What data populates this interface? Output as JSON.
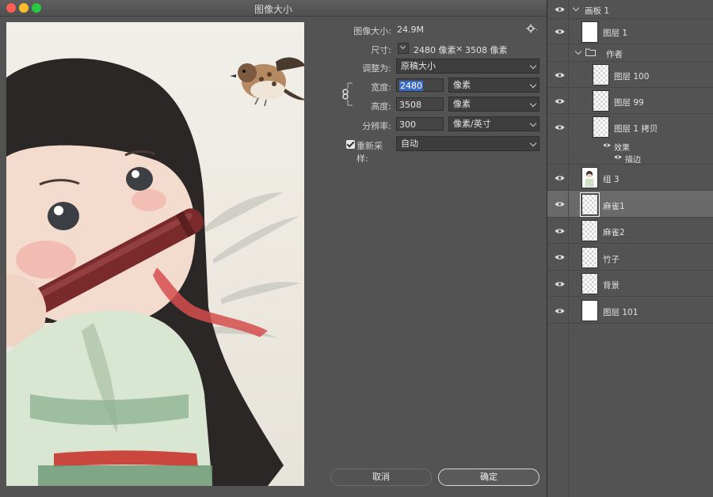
{
  "dialog": {
    "title": "图像大小",
    "image_size_label": "图像大小:",
    "image_size_value": "24.9M",
    "dimensions_label": "尺寸:",
    "dimensions_w": "2480 像素",
    "dimensions_x": "×",
    "dimensions_h": "3508 像素",
    "fit_to_label": "调整为:",
    "fit_to_value": "原稿大小",
    "width_label": "宽度:",
    "width_value": "2480",
    "width_unit": "像素",
    "height_label": "高度:",
    "height_value": "3508",
    "height_unit": "像素",
    "resolution_label": "分辨率:",
    "resolution_value": "300",
    "resolution_unit": "像素/英寸",
    "resample_label": "重新采样:",
    "resample_checked": true,
    "resample_value": "自动",
    "cancel_label": "取消",
    "ok_label": "确定"
  },
  "layers": {
    "artboard": "画板 1",
    "items": [
      {
        "name": "图层 1",
        "thumb": "white"
      },
      {
        "name": "作者",
        "thumb": "folder"
      },
      {
        "name": "图层 100",
        "thumb": "checker"
      },
      {
        "name": "图层 99",
        "thumb": "checker"
      },
      {
        "name": "图层 1 拷贝",
        "thumb": "checker"
      },
      {
        "name": "效果",
        "thumb": "none"
      },
      {
        "name": "描边",
        "thumb": "none"
      },
      {
        "name": "组 3",
        "thumb": "figure"
      },
      {
        "name": "麻雀1",
        "thumb": "checker",
        "selected": true
      },
      {
        "name": "麻雀2",
        "thumb": "checker"
      },
      {
        "name": "竹子",
        "thumb": "checker"
      },
      {
        "name": "背景",
        "thumb": "checker"
      },
      {
        "name": "图层 101",
        "thumb": "white"
      }
    ]
  },
  "colors": {
    "panel": "#535353",
    "selection": "#3b6bc4",
    "selected_row": "#6a6a6a"
  }
}
